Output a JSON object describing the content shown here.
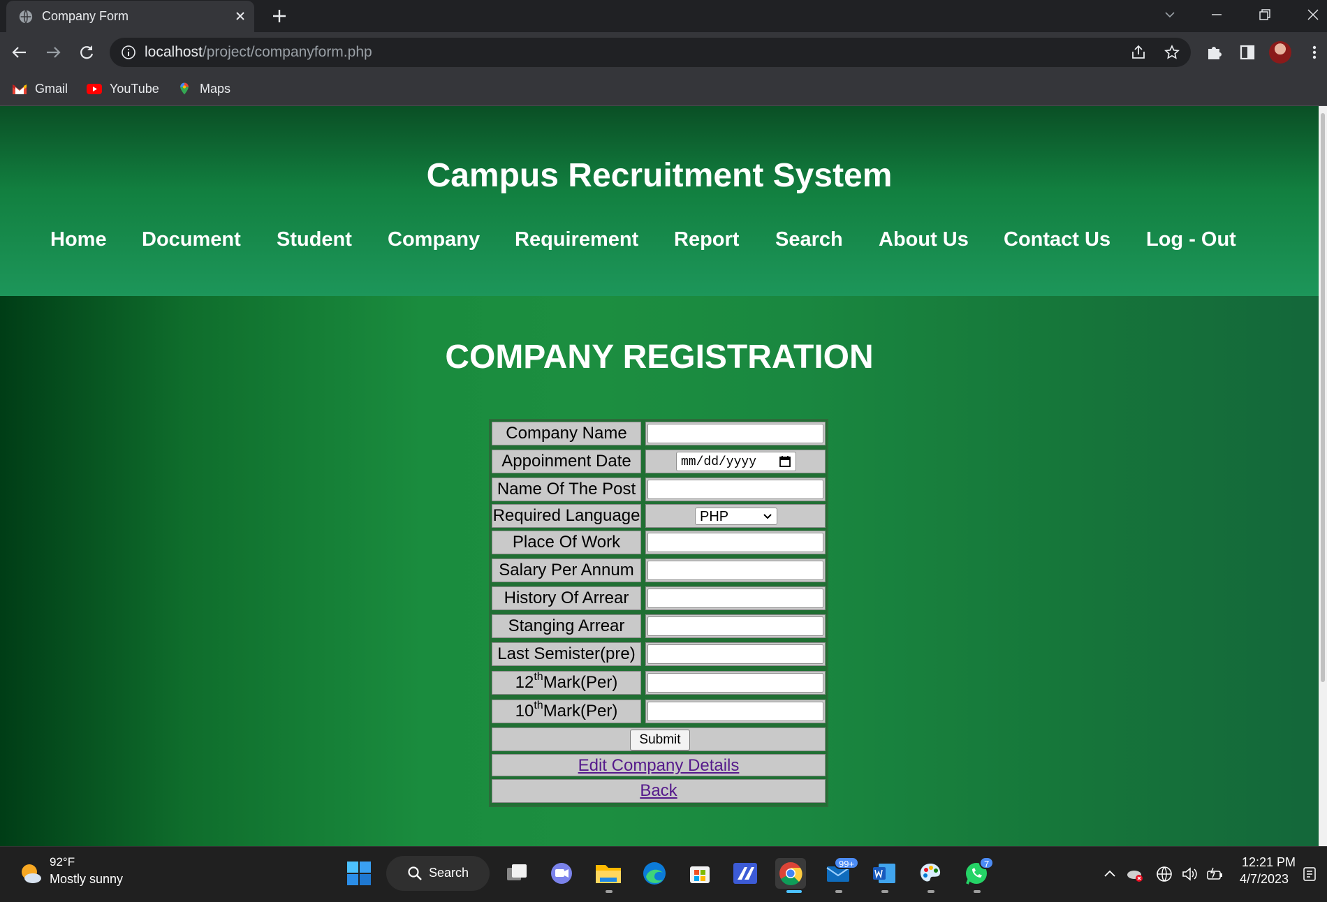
{
  "browser": {
    "tab_title": "Company Form",
    "url_host": "localhost",
    "url_path": "/project/companyform.php",
    "bookmarks": [
      "Gmail",
      "YouTube",
      "Maps"
    ]
  },
  "header": {
    "title": "Campus Recruitment System",
    "nav": [
      "Home",
      "Document",
      "Student",
      "Company",
      "Requirement",
      "Report",
      "Search",
      "About Us",
      "Contact Us",
      "Log - Out"
    ]
  },
  "form": {
    "title": "COMPANY REGISTRATION",
    "labels": {
      "company_name": "Company Name",
      "appointment_date": "Appoinment Date",
      "post_name": "Name Of The Post",
      "required_language": "Required Language",
      "place_of_work": "Place Of Work",
      "salary": "Salary Per Annum",
      "history_arrear": "History Of Arrear",
      "standing_arrear": "Stanging Arrear",
      "last_semester": "Last Semister(pre)",
      "twelfth_num": "12",
      "twelfth_sup": "th",
      "twelfth_rest": "Mark(Per)",
      "tenth_num": "10",
      "tenth_sup": "th",
      "tenth_rest": "Mark(Per)"
    },
    "date_placeholder": "mm/dd/yyyy",
    "language_selected": "PHP",
    "submit_label": "Submit",
    "edit_link": "Edit Company Details",
    "back_link": "Back"
  },
  "taskbar": {
    "weather_temp": "92°F",
    "weather_desc": "Mostly sunny",
    "search_label": "Search",
    "mail_badge": "99+",
    "whatsapp_badge": "7",
    "time": "12:21 PM",
    "date": "4/7/2023"
  },
  "colors": {
    "header_green": "#128040",
    "page_green": "#1c8e40",
    "cell_gray": "#c9c9c9",
    "link_purple": "#551a8b"
  }
}
